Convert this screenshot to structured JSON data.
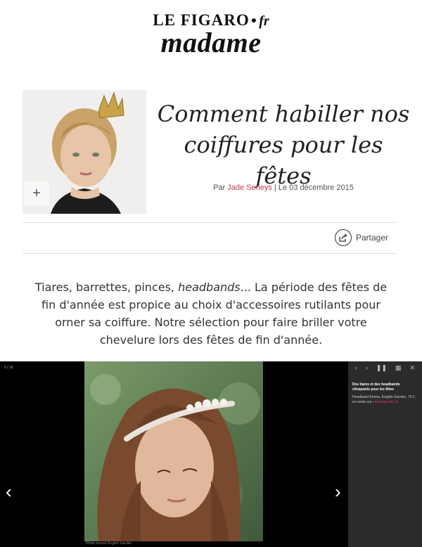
{
  "logo": {
    "top": "LE FIGARO",
    "dot": "●",
    "fr": "fr",
    "bottom": "madame"
  },
  "hero": {
    "plus": "+"
  },
  "article": {
    "title": "Comment habiller nos coiffures pour les fêtes",
    "by_prefix": "Par ",
    "author": "Jade Serieys",
    "separator": " | ",
    "date": "Le 03 décembre 2015",
    "share": "Partager",
    "intro_before": "Tiares, barrettes, pinces, ",
    "intro_em": "headbands",
    "intro_after": "... La période des fêtes de fin d'année est propice au choix d'accessoires rutilants pour orner sa coiffure. Notre sélection pour faire briller votre chevelure lors des fêtes de fin d'année."
  },
  "gallery": {
    "counter": "5 / 16",
    "prev": "‹",
    "next": "›",
    "controls": [
      "‹",
      "›",
      "❚❚",
      "▦",
      "✕"
    ],
    "caption_title": "Des tiares et des headbands clinquants pour les fêtes",
    "caption_text": "Headband Emma, English Garden, 75 €, en vente sur ",
    "caption_shop": "englishgarden.fr",
    "credit": "Photo presse English Garden"
  },
  "colors": {
    "accent": "#c33a55",
    "gallery_bg": "#000000",
    "sidebar_bg": "#2b2b2b"
  }
}
